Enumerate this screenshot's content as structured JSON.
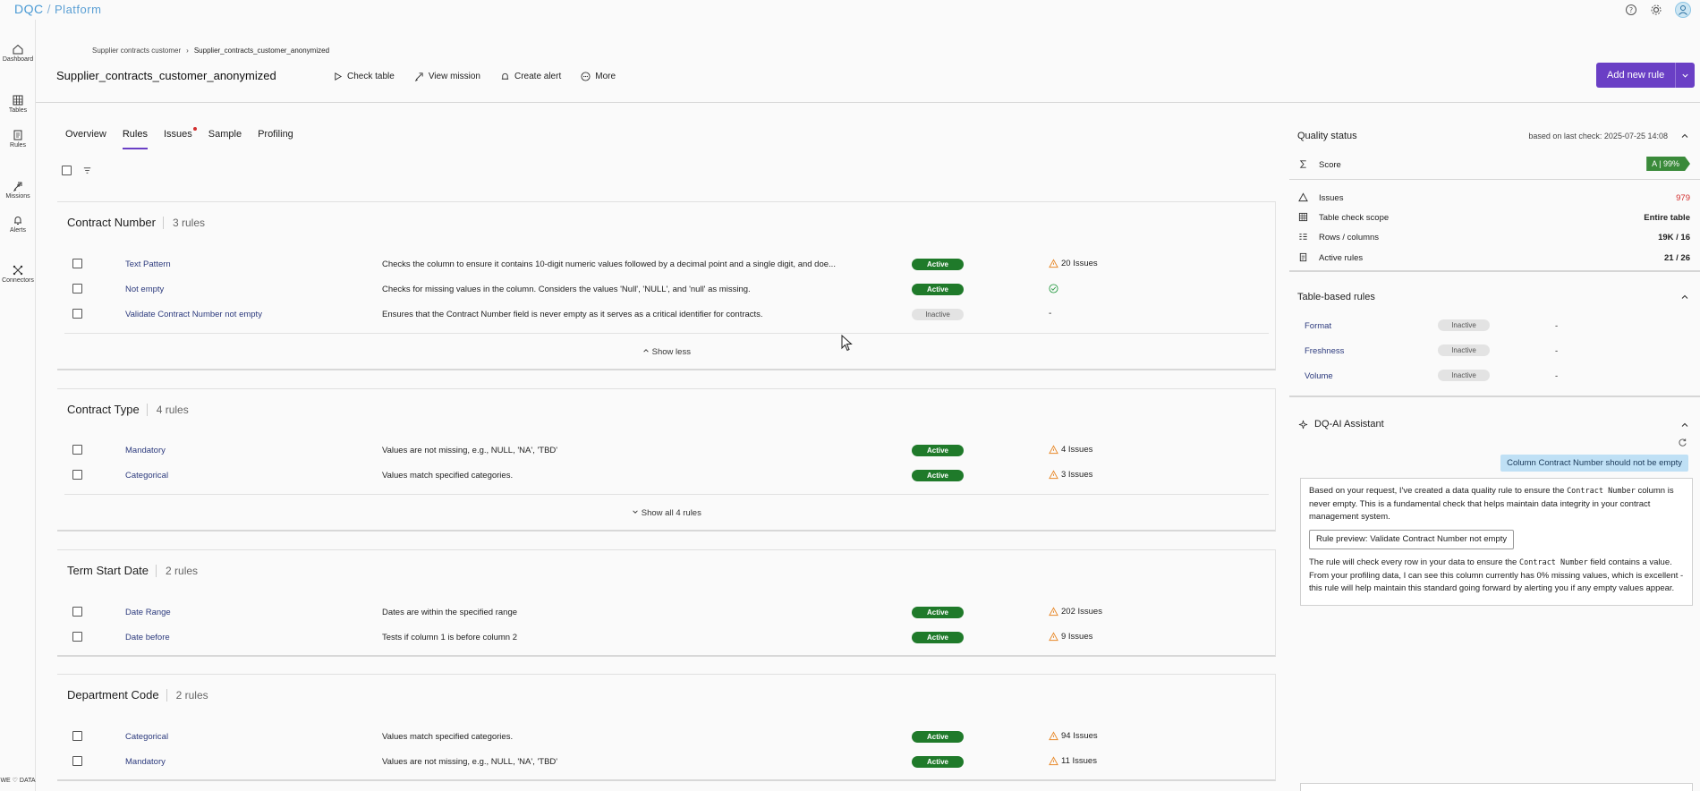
{
  "app": {
    "logo": "DQC",
    "product": "Platform"
  },
  "nav": [
    {
      "label": "Dashboard",
      "icon": "home-icon"
    },
    {
      "label": "Tables",
      "icon": "table-icon"
    },
    {
      "label": "Rules",
      "icon": "rules-icon"
    },
    {
      "label": "Missions",
      "icon": "rocket-icon"
    },
    {
      "label": "Alerts",
      "icon": "bell-icon"
    },
    {
      "label": "Connectors",
      "icon": "connectors-icon"
    }
  ],
  "footer_brand": "WE ♡ DATA",
  "breadcrumb": {
    "parent": "Supplier contracts customer",
    "current": "Supplier_contracts_customer_anonymized"
  },
  "page_title": "Supplier_contracts_customer_anonymized",
  "actions": {
    "check_table": "Check table",
    "view_mission": "View mission",
    "create_alert": "Create alert",
    "more": "More"
  },
  "add_rule_label": "Add new rule",
  "tabs": [
    "Overview",
    "Rules",
    "Issues",
    "Sample",
    "Profiling"
  ],
  "groups": [
    {
      "title": "Contract Number",
      "count": "3 rules",
      "rules": [
        {
          "name": "Text Pattern",
          "desc": "Checks the column to ensure it contains 10-digit numeric values followed by a decimal point and a single digit, and doe...",
          "status": "Active",
          "issues": "20 Issues"
        },
        {
          "name": "Not empty",
          "desc": "Checks for missing values in the column. Considers the values 'Null', 'NULL', and 'null' as missing.",
          "status": "Active",
          "issues": ""
        },
        {
          "name": "Validate Contract Number not empty",
          "desc": "Ensures that the Contract Number field is never empty as it serves as a critical identifier for contracts.",
          "status": "Inactive",
          "issues": "-"
        }
      ],
      "toggle": "Show less"
    },
    {
      "title": "Contract Type",
      "count": "4 rules",
      "rules": [
        {
          "name": "Mandatory",
          "desc": "Values are not missing, e.g., NULL, 'NA', 'TBD'",
          "status": "Active",
          "issues": "4 Issues"
        },
        {
          "name": "Categorical",
          "desc": "Values match specified categories.",
          "status": "Active",
          "issues": "3 Issues"
        }
      ],
      "toggle": "Show all 4 rules"
    },
    {
      "title": "Term Start Date",
      "count": "2 rules",
      "rules": [
        {
          "name": "Date Range",
          "desc": "Dates are within the specified range",
          "status": "Active",
          "issues": "202 Issues"
        },
        {
          "name": "Date before",
          "desc": "Tests if column 1 is before column 2",
          "status": "Active",
          "issues": "9 Issues"
        }
      ]
    },
    {
      "title": "Department Code",
      "count": "2 rules",
      "rules": [
        {
          "name": "Categorical",
          "desc": "Values match specified categories.",
          "status": "Active",
          "issues": "94 Issues"
        },
        {
          "name": "Mandatory",
          "desc": "Values are not missing, e.g., NULL, 'NA', 'TBD'",
          "status": "Active",
          "issues": "11 Issues"
        }
      ]
    }
  ],
  "quality": {
    "title": "Quality status",
    "last_check": "based on last check: 2025-07-25 14:08",
    "score_label": "Score",
    "score_value": "A | 99%",
    "issues_label": "Issues",
    "issues_value": "979",
    "scope_label": "Table check scope",
    "scope_value": "Entire table",
    "rows_label": "Rows / columns",
    "rows_value": "19K / 16",
    "active_label": "Active rules",
    "active_value": "21 / 26"
  },
  "table_rules": {
    "title": "Table-based rules",
    "items": [
      {
        "name": "Format",
        "status": "Inactive",
        "value": "-"
      },
      {
        "name": "Freshness",
        "status": "Inactive",
        "value": "-"
      },
      {
        "name": "Volume",
        "status": "Inactive",
        "value": "-"
      }
    ]
  },
  "assistant": {
    "title": "DQ-AI Assistant",
    "user_msg": "Column Contract Number should not be empty",
    "p1_a": "Based on your request, I've created a data quality rule to ensure the ",
    "p1_code": "Contract Number",
    "p1_b": " column is never empty. This is a fundamental check that helps maintain data integrity in your contract management system.",
    "preview_btn": "Rule preview: Validate Contract Number not empty",
    "p2_a": "The rule will check every row in your data to ensure the ",
    "p2_code": "Contract Number",
    "p2_b": " field contains a value. From your profiling data, I can see this column currently has 0% missing values, which is excellent - this rule will help maintain this standard going forward by alerting you if any empty values appear."
  },
  "colors": {
    "accent": "#6a3fc5",
    "active": "#1f7a2a",
    "warning": "#e8892a",
    "danger": "#d32f2f",
    "ok": "#2e9e48"
  }
}
